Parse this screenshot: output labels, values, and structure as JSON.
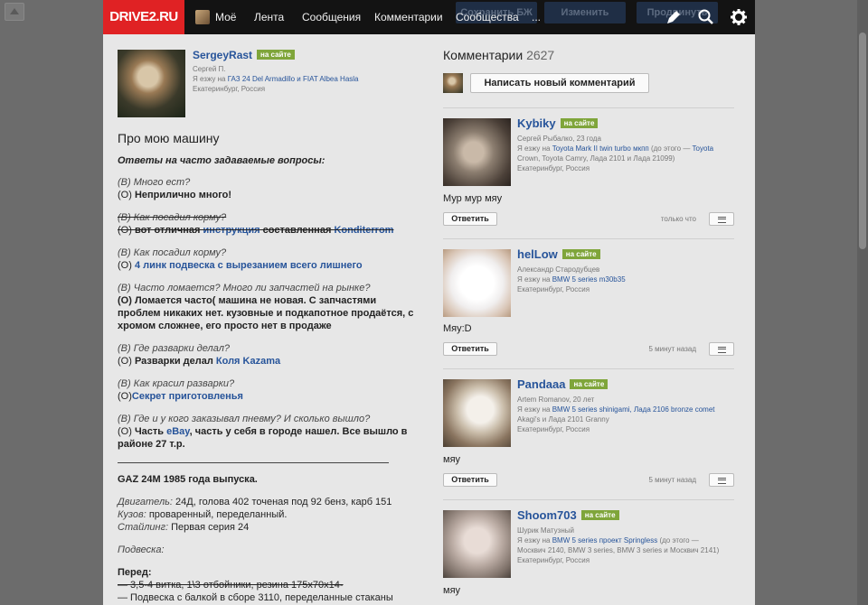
{
  "header": {
    "logo": "DRIVE2.RU",
    "nav": [
      "Моё",
      "Лента",
      "Сообщения",
      "Комментарии",
      "Сообщества",
      "..."
    ],
    "ghost_buttons": [
      "Сохранить БЖ",
      "Изменить",
      "Продвинуть"
    ]
  },
  "profile": {
    "name": "SergeyRast",
    "badge": "на сайте",
    "real_name": "Сергей П.",
    "drives_prefix": "Я езжу на",
    "drives_cars": "ГАЗ 24 Del Armadillo и FIAT Albea Hasla",
    "city": "Екатеринбург, Россия"
  },
  "about": {
    "title": "Про мою машину",
    "faq_heading": "Ответы на часто задаваемые вопросы:",
    "q1": "(В) Много ест?",
    "a1_prefix": "(О) ",
    "a1": "Неприлично много!",
    "q2": "(В) Как посадил корму?",
    "a2_prefix": "(О) ",
    "a2_text1": "вот отличная ",
    "a2_link1": "инструкция",
    "a2_text2": " составленная ",
    "a2_link2": "Konditerrom",
    "q3": "(В) Как посадил корму?",
    "a3_prefix": "(О) ",
    "a3_link": "4 линк подвеска с вырезанием всего лишнего",
    "q4": "(В) Часто ломается? Много ли запчастей на рынке?",
    "a4_line1": "(О) Ломается часто( машина не новая. С запчастями",
    "a4_line2": "проблем никаких нет. кузовные и подкапотное продаётся, с",
    "a4_line3": "хромом сложнее, его просто нет в продаже",
    "q5": "(В) Где разварки делал?",
    "a5_prefix": "(О) ",
    "a5_text": "Разварки делал ",
    "a5_link": "Коля Kazama",
    "q6": "(В) Как красил разварки?",
    "a6_prefix": "(О)",
    "a6_link": "Секрет приготовленья",
    "q7": "(В) Где и у кого заказывал пневму? И сколько вышло?",
    "a7_prefix": "(О) ",
    "a7_text1": "Часть ",
    "a7_link": "eBay",
    "a7_text2": ", часть у себя в городе нашел. Все вышло в",
    "a7_line2": "районе 27 т.р.",
    "car_title": "GAZ 24M 1985 года выпуска.",
    "engine_label": "Двигатель:",
    "engine_value": " 24Д, голова 402 точеная под 92 бенз, карб 151",
    "body_label": "Кузов:",
    "body_value": " проваренный, переделанный.",
    "styling_label": "Стайлинг:",
    "styling_value": " Первая серия 24",
    "suspension_label": "Подвеска:",
    "front_label": "Перед:",
    "front_line1": "— 3,5-4 витка, 1\\3 отбойники, резина 175х70х14-",
    "front_line2": "— Подвеска с балкой в сборе 3110, переделанные стаканы"
  },
  "comments_section": {
    "title": "Комментарии",
    "count": "2627",
    "write_button": "Написать новый комментарий"
  },
  "comments": [
    {
      "name": "Kybiky",
      "badge": "на сайте",
      "meta": "Сергей Рыбалко, 23 года",
      "drives_prefix": "Я езжу на",
      "cars_line1": "Toyota Mark II twin turbo мкпп",
      "cars_mid": " (до этого — ",
      "cars_line1_end": "Toyota",
      "cars_line2": "Crown, Toyota Camry, Лада 2101 и Лада 21099)",
      "city": "Екатеринбург, Россия",
      "text": "Мур мур мяу",
      "reply": "Ответить",
      "time": "только что"
    },
    {
      "name": "helLow",
      "badge": "на сайте",
      "meta": "Александр Стародубцев",
      "drives_prefix": "Я езжу на",
      "cars_line1": "BMW 5 series m30b35",
      "city": "Екатеринбург, Россия",
      "text": "Мяу:D",
      "reply": "Ответить",
      "time": "5 минут назад"
    },
    {
      "name": "Pandaaa",
      "badge": "на сайте",
      "meta": "Artem Romanov, 20 лет",
      "drives_prefix": "Я езжу на",
      "cars_line1": "BMW 5 series shinigami, Лада 2106 bronze comet",
      "cars_line2": "Akagi's и Лада 2101 Granny",
      "city": "Екатеринбург, Россия",
      "text": "мяу",
      "reply": "Ответить",
      "time": "5 минут назад"
    },
    {
      "name": "Shoom703",
      "badge": "на сайте",
      "meta": "Шурик Матузный",
      "drives_prefix": "Я езжу на",
      "cars_line1": "BMW 5 series проект Springless",
      "cars_mid": " (до этого —",
      "cars_line2": "Москвич 2140, BMW 3 series, BMW 3 series и Москвич 2141)",
      "city": "Екатеринбург, Россия",
      "text": "мяу"
    }
  ],
  "icons": [
    "home-up-icon",
    "pencil-icon",
    "search-icon",
    "gear-icon",
    "menu-icon"
  ],
  "colors": {
    "brand": "#e02224",
    "link": "#27549a",
    "online": "#7fa53a",
    "topbar": "#131313"
  }
}
